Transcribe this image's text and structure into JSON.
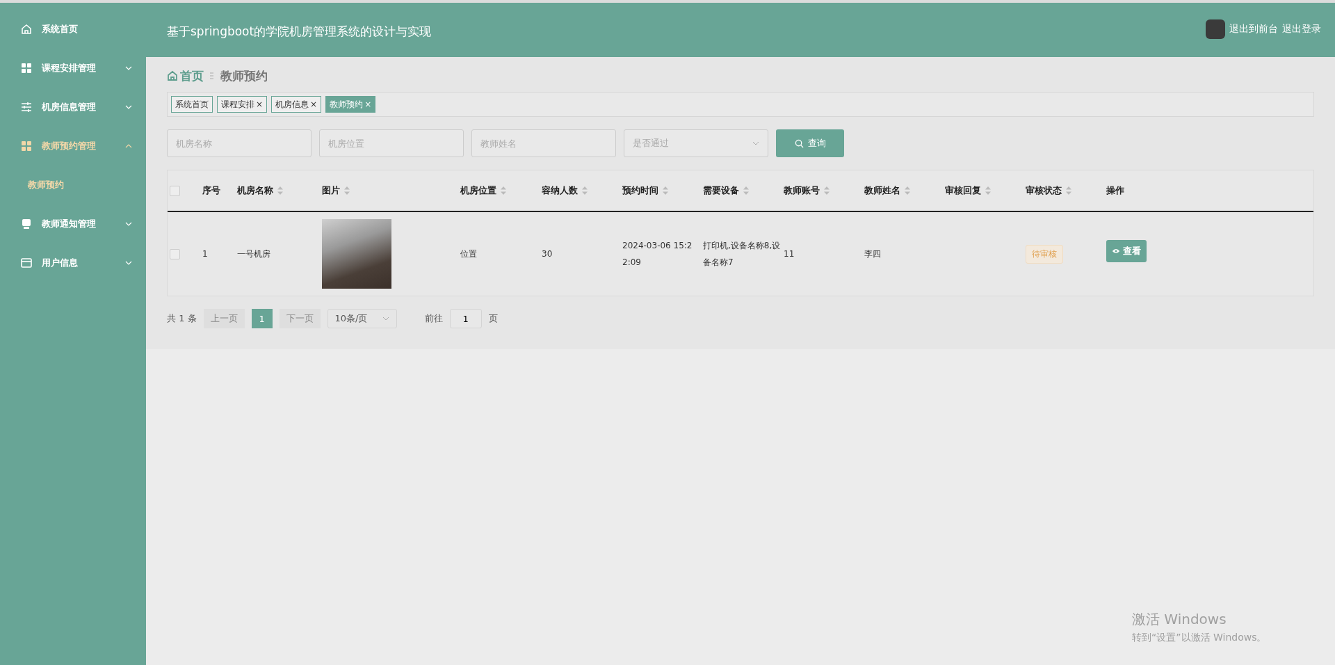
{
  "sidebar": {
    "items": [
      {
        "label": "系统首页",
        "kind": "link",
        "expanded": false,
        "selected": false
      },
      {
        "label": "课程安排管理",
        "kind": "menu",
        "expanded": false,
        "selected": false
      },
      {
        "label": "机房信息管理",
        "kind": "menu",
        "expanded": false,
        "selected": false
      },
      {
        "label": "教师预约管理",
        "kind": "menu",
        "expanded": true,
        "selected": false,
        "children": [
          {
            "label": "教师预约",
            "selected": true
          }
        ]
      },
      {
        "label": "教师通知管理",
        "kind": "menu",
        "expanded": false,
        "selected": false
      },
      {
        "label": "用户信息",
        "kind": "menu",
        "expanded": false,
        "selected": false
      }
    ]
  },
  "header": {
    "title": "基于springboot的学院机房管理系统的设计与实现",
    "actions": [
      "退出到前台",
      "退出登录"
    ]
  },
  "breadcrumb": {
    "home": "首页",
    "current": "教师预约"
  },
  "tabs": [
    {
      "label": "系统首页",
      "selected": false
    },
    {
      "label": "课程安排",
      "close": "×",
      "selected": false
    },
    {
      "label": "机房信息",
      "close": "×",
      "selected": false
    },
    {
      "label": "教师预约",
      "close": "×",
      "selected": true
    }
  ],
  "search": {
    "fields": [
      {
        "kind": "input",
        "placeholder": "机房名称"
      },
      {
        "kind": "input",
        "placeholder": "机房位置"
      },
      {
        "kind": "input",
        "placeholder": "教师姓名"
      },
      {
        "kind": "select",
        "placeholder": "是否通过"
      }
    ],
    "button": "查询"
  },
  "table": {
    "select_all": {
      "checked": false
    },
    "columns": [
      {
        "label": "序号",
        "sortable": false
      },
      {
        "label": "机房名称",
        "sortable": true
      },
      {
        "label": "图片",
        "sortable": true
      },
      {
        "label": "机房位置",
        "sortable": true
      },
      {
        "label": "容纳人数",
        "sortable": true
      },
      {
        "label": "预约时间",
        "sortable": true
      },
      {
        "label": "需要设备",
        "sortable": true
      },
      {
        "label": "教师账号",
        "sortable": true
      },
      {
        "label": "教师姓名",
        "sortable": true
      },
      {
        "label": "审核回复",
        "sortable": true
      },
      {
        "label": "审核状态",
        "sortable": true
      },
      {
        "label": "操作",
        "sortable": false
      }
    ],
    "rows": [
      {
        "checked": false,
        "cells": [
          {
            "kind": "text",
            "text": "1"
          },
          {
            "kind": "text",
            "text": "一号机房"
          },
          {
            "kind": "image"
          },
          {
            "kind": "text",
            "text": "位置"
          },
          {
            "kind": "text",
            "text": "30"
          },
          {
            "kind": "text",
            "text": "2024-03-06 15:22:09"
          },
          {
            "kind": "text",
            "text": "打印机,设备名称8,设备名称7"
          },
          {
            "kind": "text",
            "text": "11"
          },
          {
            "kind": "text",
            "text": "李四"
          },
          {
            "kind": "empty"
          },
          {
            "kind": "tag",
            "text": "待审核"
          },
          {
            "kind": "button",
            "text": "查看"
          }
        ]
      }
    ]
  },
  "pagination": {
    "total": "共 1 条",
    "prev": {
      "label": "上一页",
      "disabled": true
    },
    "pages": [
      {
        "label": "1",
        "selected": true
      }
    ],
    "next": {
      "label": "下一页",
      "disabled": true
    },
    "page_size": "10条/页",
    "goto": "前往",
    "goto_value": "1",
    "goto_suffix": "页"
  },
  "os_notice": {
    "title": "激活 Windows",
    "text": "转到“设置”以激活 Windows。"
  }
}
